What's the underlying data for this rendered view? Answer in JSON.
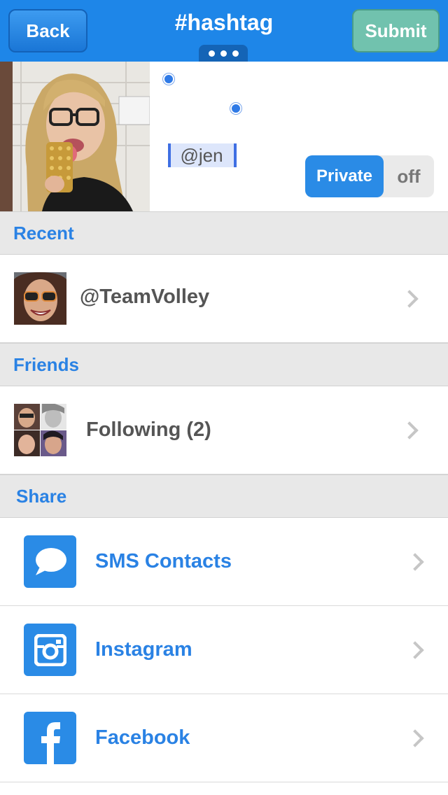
{
  "header": {
    "back_label": "Back",
    "title": "#hashtag",
    "submit_label": "Submit"
  },
  "composer": {
    "mention_text": "@jen",
    "privacy_toggle": {
      "on_label": "Private",
      "off_label": "off",
      "state": "Private"
    }
  },
  "sections": {
    "recent": {
      "title": "Recent",
      "items": [
        {
          "label": "@TeamVolley"
        }
      ]
    },
    "friends": {
      "title": "Friends",
      "items": [
        {
          "label": "Following (2)"
        }
      ]
    },
    "share": {
      "title": "Share",
      "items": [
        {
          "label": "SMS Contacts",
          "icon": "chat-bubble-icon"
        },
        {
          "label": "Instagram",
          "icon": "instagram-icon"
        },
        {
          "label": "Facebook",
          "icon": "facebook-icon"
        }
      ]
    }
  },
  "colors": {
    "accent": "#1e86e8",
    "submit": "#71c2ae",
    "section_bg": "#e8e8e8",
    "link_text": "#2a82e4"
  }
}
